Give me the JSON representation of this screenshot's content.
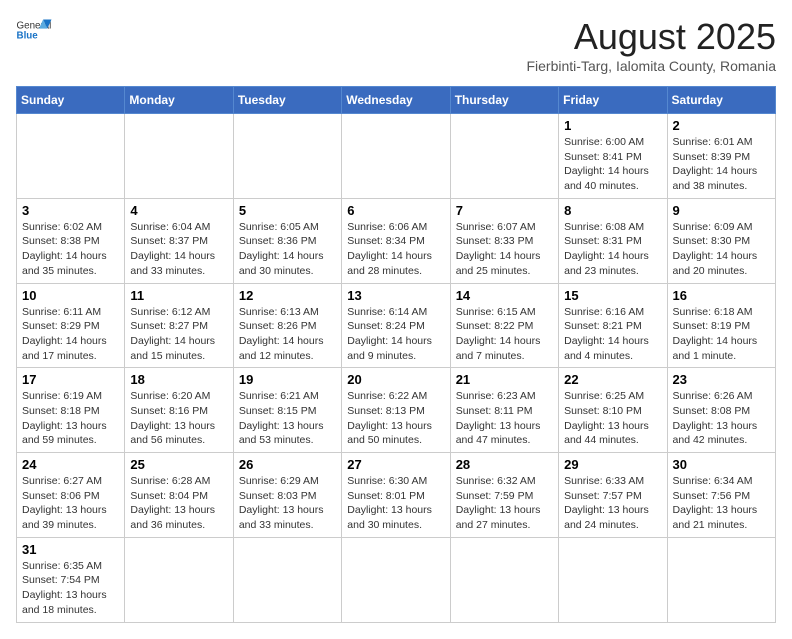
{
  "header": {
    "logo_general": "General",
    "logo_blue": "Blue",
    "title": "August 2025",
    "subtitle": "Fierbinti-Targ, Ialomita County, Romania"
  },
  "weekdays": [
    "Sunday",
    "Monday",
    "Tuesday",
    "Wednesday",
    "Thursday",
    "Friday",
    "Saturday"
  ],
  "weeks": [
    [
      {
        "day": "",
        "info": ""
      },
      {
        "day": "",
        "info": ""
      },
      {
        "day": "",
        "info": ""
      },
      {
        "day": "",
        "info": ""
      },
      {
        "day": "",
        "info": ""
      },
      {
        "day": "1",
        "info": "Sunrise: 6:00 AM\nSunset: 8:41 PM\nDaylight: 14 hours and 40 minutes."
      },
      {
        "day": "2",
        "info": "Sunrise: 6:01 AM\nSunset: 8:39 PM\nDaylight: 14 hours and 38 minutes."
      }
    ],
    [
      {
        "day": "3",
        "info": "Sunrise: 6:02 AM\nSunset: 8:38 PM\nDaylight: 14 hours and 35 minutes."
      },
      {
        "day": "4",
        "info": "Sunrise: 6:04 AM\nSunset: 8:37 PM\nDaylight: 14 hours and 33 minutes."
      },
      {
        "day": "5",
        "info": "Sunrise: 6:05 AM\nSunset: 8:36 PM\nDaylight: 14 hours and 30 minutes."
      },
      {
        "day": "6",
        "info": "Sunrise: 6:06 AM\nSunset: 8:34 PM\nDaylight: 14 hours and 28 minutes."
      },
      {
        "day": "7",
        "info": "Sunrise: 6:07 AM\nSunset: 8:33 PM\nDaylight: 14 hours and 25 minutes."
      },
      {
        "day": "8",
        "info": "Sunrise: 6:08 AM\nSunset: 8:31 PM\nDaylight: 14 hours and 23 minutes."
      },
      {
        "day": "9",
        "info": "Sunrise: 6:09 AM\nSunset: 8:30 PM\nDaylight: 14 hours and 20 minutes."
      }
    ],
    [
      {
        "day": "10",
        "info": "Sunrise: 6:11 AM\nSunset: 8:29 PM\nDaylight: 14 hours and 17 minutes."
      },
      {
        "day": "11",
        "info": "Sunrise: 6:12 AM\nSunset: 8:27 PM\nDaylight: 14 hours and 15 minutes."
      },
      {
        "day": "12",
        "info": "Sunrise: 6:13 AM\nSunset: 8:26 PM\nDaylight: 14 hours and 12 minutes."
      },
      {
        "day": "13",
        "info": "Sunrise: 6:14 AM\nSunset: 8:24 PM\nDaylight: 14 hours and 9 minutes."
      },
      {
        "day": "14",
        "info": "Sunrise: 6:15 AM\nSunset: 8:22 PM\nDaylight: 14 hours and 7 minutes."
      },
      {
        "day": "15",
        "info": "Sunrise: 6:16 AM\nSunset: 8:21 PM\nDaylight: 14 hours and 4 minutes."
      },
      {
        "day": "16",
        "info": "Sunrise: 6:18 AM\nSunset: 8:19 PM\nDaylight: 14 hours and 1 minute."
      }
    ],
    [
      {
        "day": "17",
        "info": "Sunrise: 6:19 AM\nSunset: 8:18 PM\nDaylight: 13 hours and 59 minutes."
      },
      {
        "day": "18",
        "info": "Sunrise: 6:20 AM\nSunset: 8:16 PM\nDaylight: 13 hours and 56 minutes."
      },
      {
        "day": "19",
        "info": "Sunrise: 6:21 AM\nSunset: 8:15 PM\nDaylight: 13 hours and 53 minutes."
      },
      {
        "day": "20",
        "info": "Sunrise: 6:22 AM\nSunset: 8:13 PM\nDaylight: 13 hours and 50 minutes."
      },
      {
        "day": "21",
        "info": "Sunrise: 6:23 AM\nSunset: 8:11 PM\nDaylight: 13 hours and 47 minutes."
      },
      {
        "day": "22",
        "info": "Sunrise: 6:25 AM\nSunset: 8:10 PM\nDaylight: 13 hours and 44 minutes."
      },
      {
        "day": "23",
        "info": "Sunrise: 6:26 AM\nSunset: 8:08 PM\nDaylight: 13 hours and 42 minutes."
      }
    ],
    [
      {
        "day": "24",
        "info": "Sunrise: 6:27 AM\nSunset: 8:06 PM\nDaylight: 13 hours and 39 minutes."
      },
      {
        "day": "25",
        "info": "Sunrise: 6:28 AM\nSunset: 8:04 PM\nDaylight: 13 hours and 36 minutes."
      },
      {
        "day": "26",
        "info": "Sunrise: 6:29 AM\nSunset: 8:03 PM\nDaylight: 13 hours and 33 minutes."
      },
      {
        "day": "27",
        "info": "Sunrise: 6:30 AM\nSunset: 8:01 PM\nDaylight: 13 hours and 30 minutes."
      },
      {
        "day": "28",
        "info": "Sunrise: 6:32 AM\nSunset: 7:59 PM\nDaylight: 13 hours and 27 minutes."
      },
      {
        "day": "29",
        "info": "Sunrise: 6:33 AM\nSunset: 7:57 PM\nDaylight: 13 hours and 24 minutes."
      },
      {
        "day": "30",
        "info": "Sunrise: 6:34 AM\nSunset: 7:56 PM\nDaylight: 13 hours and 21 minutes."
      }
    ],
    [
      {
        "day": "31",
        "info": "Sunrise: 6:35 AM\nSunset: 7:54 PM\nDaylight: 13 hours and 18 minutes."
      },
      {
        "day": "",
        "info": ""
      },
      {
        "day": "",
        "info": ""
      },
      {
        "day": "",
        "info": ""
      },
      {
        "day": "",
        "info": ""
      },
      {
        "day": "",
        "info": ""
      },
      {
        "day": "",
        "info": ""
      }
    ]
  ]
}
